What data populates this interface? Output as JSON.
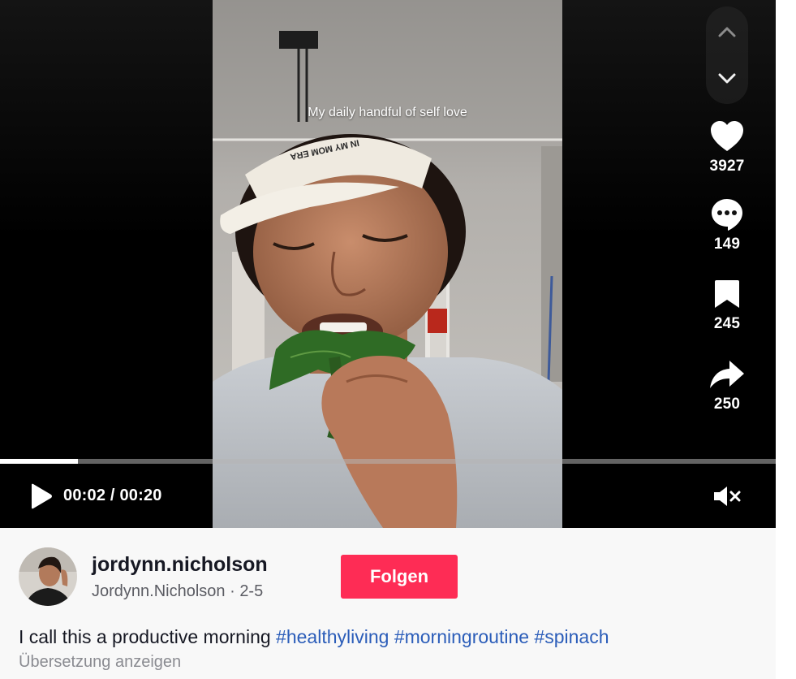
{
  "video": {
    "overlay_caption": "My daily handful of self love",
    "cap_text": "IN MY MOM ERA",
    "progress": 0.1,
    "time_current": "00:02",
    "time_total": "00:20",
    "time_separator": " / "
  },
  "actions": {
    "likes": "3927",
    "comments": "149",
    "saves": "245",
    "shares": "250"
  },
  "author": {
    "username": "jordynn.nicholson",
    "display_name": "Jordynn.Nicholson",
    "separator": " · ",
    "date": "2-5",
    "follow_label": "Folgen"
  },
  "description": {
    "text": "I call this a productive morning",
    "hashtags": [
      "#healthyliving",
      "#morningroutine",
      "#spinach"
    ],
    "translate_label": "Übersetzung anzeigen"
  },
  "colors": {
    "follow_bg": "#fe2c55",
    "hashtag": "#2b5db9",
    "info_bg": "#f8f8f8"
  },
  "icons": {
    "nav_up": "chevron-up-icon",
    "nav_down": "chevron-down-icon",
    "like": "heart-icon",
    "comment": "comment-icon",
    "save": "bookmark-icon",
    "share": "share-icon",
    "play": "play-icon",
    "mute": "volume-muted-icon"
  }
}
